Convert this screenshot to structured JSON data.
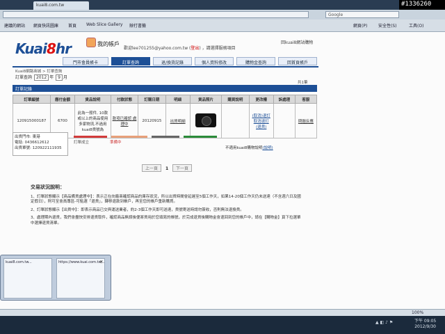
{
  "overlay_id": "#1336260",
  "browser": {
    "tab_title": "kuai8.com.tw",
    "search_placeholder": "Google",
    "bookmarks": [
      "建議的網站",
      "網頁快訊圖庫",
      "首頁",
      "Web Slice Gallery",
      "辦打書籤"
    ],
    "right_tools": [
      "網頁(P)",
      "安全性(S)",
      "工具(O)"
    ]
  },
  "site": {
    "logo_main": "Kuai",
    "logo_eight": "8",
    "logo_suffix": "hr",
    "my_account": "我的帳戶",
    "greeting_pre": "歡迎lee701255@yahoo.com.tw (",
    "logout": "登出",
    "greeting_post": ") ，請選擇服務項目",
    "top_link": "回kuai8網站購物",
    "nav": [
      "門市會員帳卡",
      "訂單查詢",
      "退/換貨記錄",
      "個人資料修改",
      "購物金查詢",
      "回首頁帳戶"
    ],
    "breadcrumb": "Kuai8網路商城 > 訂單查詢",
    "query": {
      "label": "訂單查詢",
      "year": "2012",
      "year_unit": "年",
      "month": "9",
      "month_unit": "月"
    },
    "page_count": "共1筆",
    "section_title": "訂單記錄"
  },
  "orders": {
    "headers": [
      "訂單編號",
      "應付金額",
      "貨品說明",
      "付款狀態",
      "訂購日期",
      "明細",
      "貨品照片",
      "購買說明",
      "更改權",
      "訴處理",
      "客服"
    ],
    "row": {
      "order_no": "120915000187",
      "amount": "6700",
      "goods_desc": "此為一般件, 10款或以上的商品使用多家物流,不過用kuai8貨號為",
      "pay_status": "款項已確認 處理中",
      "order_date": "20120915",
      "detail": "出貨明細",
      "photo_alt": "camera",
      "change_1": "(取消)退訂",
      "change_2": "取消退訂",
      "change_3": "(退貨)",
      "service": "問題反應"
    }
  },
  "shipping": {
    "line1": "出貨門市: 東港",
    "line2": "電話: 0436612612",
    "line3": "出貨單號: 120922111935"
  },
  "progress": {
    "stages": [
      "訂單成立",
      "準備中"
    ],
    "colors": [
      "#d33b3b",
      "#e8a07a",
      "#666666",
      "#2b8c3a"
    ]
  },
  "invoice_text": "不適用kuai8購物說明",
  "invoice_link": "(說明)",
  "pager": {
    "prev": "上一頁",
    "current": "1",
    "next": "下一頁"
  },
  "notes": {
    "title": "交易狀況說明：",
    "items": [
      "1、訂單狀態顯示【商品備貨處理中】：表示正在向廠商確認商品的庫存狀況，所以出貨時間會延遲至5個工作天，如果14-20個工作天仍未送達（不含週六日及國定假日），則可至會員專區-可點選「退貨」，轉移退款到帳戶，再至您的帳戶重新購買。",
      "2、訂單狀態顯示【出貨中】：即表示商品已交與運送業者，約2-3個工作天即可送達，貨號寄送時請勿簽收，否則無法退換貨。",
      "3、處理期內退貨，我們會盡快安排退貨取件，確認商品無誤後便將貨用於您填寫的帳號，於完成退貨後購物金會退回到您的帳戶中，請在【購物金】頁下拉選單中選擇退貨清單。"
    ]
  },
  "taskbar": {
    "thumb1_title": "kuai8.com.tw...",
    "thumb2_title": "https://www.kuai.com.tw/..."
  },
  "status": {
    "zoom": "100%",
    "time": "下午 09:05",
    "date": "2012/9/30"
  }
}
